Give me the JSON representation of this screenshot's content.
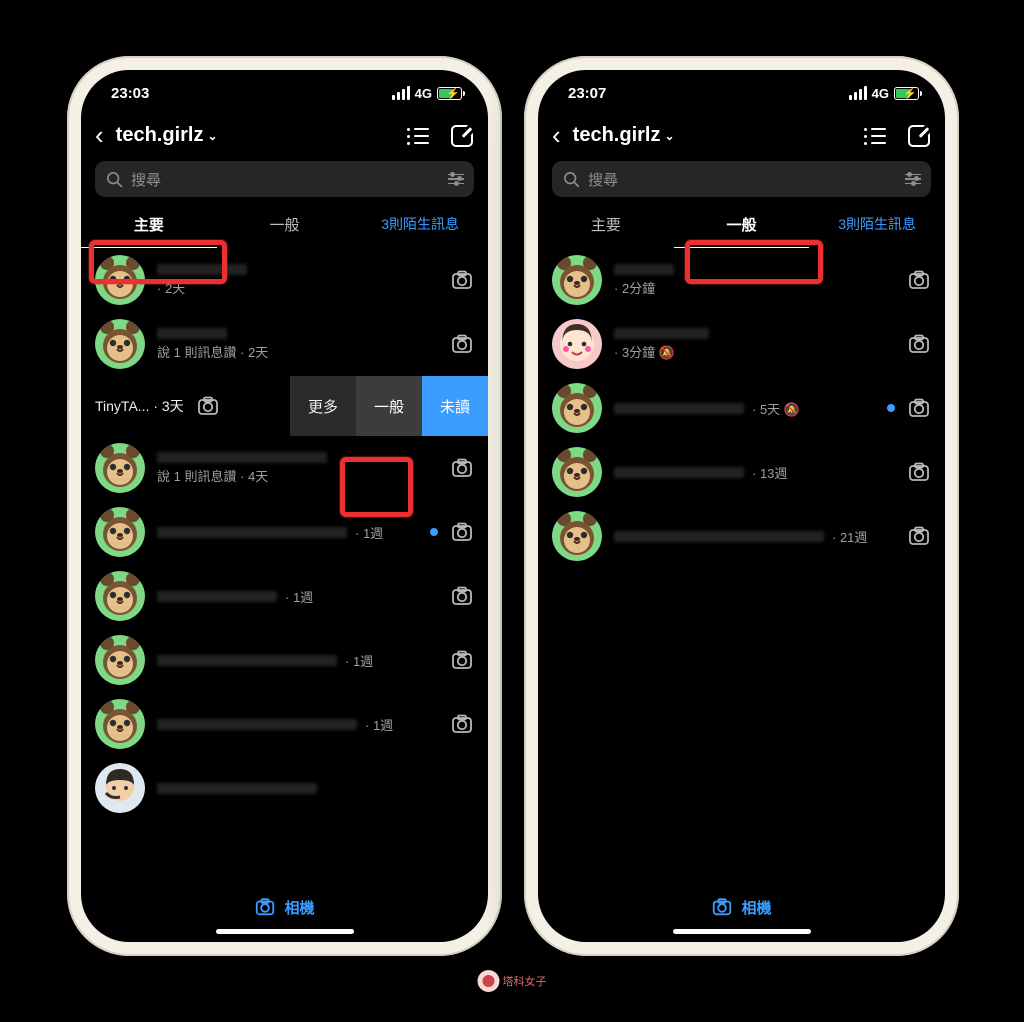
{
  "left": {
    "time": "23:03",
    "network": "4G",
    "username": "tech.girlz",
    "search_placeholder": "搜尋",
    "tabs": {
      "primary": "主要",
      "general": "一般",
      "requests": "3則陌生訊息",
      "active": "primary"
    },
    "rows": [
      {
        "avatar": "nook",
        "nameW": 90,
        "line2": "· 2天",
        "camera": true
      },
      {
        "avatar": "nook",
        "nameW": 70,
        "line2": "說 1 則訊息讚 · 2天",
        "camera": true
      },
      {
        "swiped": true,
        "avatar": "none",
        "leftText": "TinyTA...  · 3天",
        "leftCamera": true,
        "actions": {
          "more": "更多",
          "general": "一般",
          "unread": "未讀"
        }
      },
      {
        "avatar": "nook",
        "nameW": 170,
        "line2": "說 1 則訊息讚 · 4天",
        "camera": true
      },
      {
        "avatar": "nook",
        "nameW": 190,
        "line2r": "· 1週",
        "unread": true,
        "camera": true
      },
      {
        "avatar": "nook",
        "nameW": 120,
        "line2r": "· 1週",
        "camera": true
      },
      {
        "avatar": "nook",
        "nameW": 180,
        "line2r": "· 1週",
        "camera": true
      },
      {
        "avatar": "nook",
        "nameW": 200,
        "line2r": "· 1週",
        "camera": true
      },
      {
        "avatar": "memoji",
        "nameW": 160,
        "line2r": "",
        "camera": false
      }
    ],
    "camera_label": "相機"
  },
  "right": {
    "time": "23:07",
    "network": "4G",
    "username": "tech.girlz",
    "search_placeholder": "搜尋",
    "tabs": {
      "primary": "主要",
      "general": "一般",
      "requests": "3則陌生訊息",
      "active": "general"
    },
    "rows": [
      {
        "avatar": "nook",
        "nameW": 60,
        "line2": "· 2分鐘",
        "camera": true
      },
      {
        "avatar": "girl",
        "nameW": 95,
        "line2": "· 3分鐘 🔕",
        "camera": true
      },
      {
        "avatar": "nook",
        "nameW": 130,
        "line2r": "· 5天 🔕",
        "unread": true,
        "camera": true
      },
      {
        "avatar": "nook",
        "nameW": 130,
        "line2r": "· 13週",
        "camera": true
      },
      {
        "avatar": "nook",
        "nameW": 210,
        "line2r": "· 21週",
        "camera": true
      }
    ],
    "camera_label": "相機"
  },
  "watermark": "塔科女子"
}
